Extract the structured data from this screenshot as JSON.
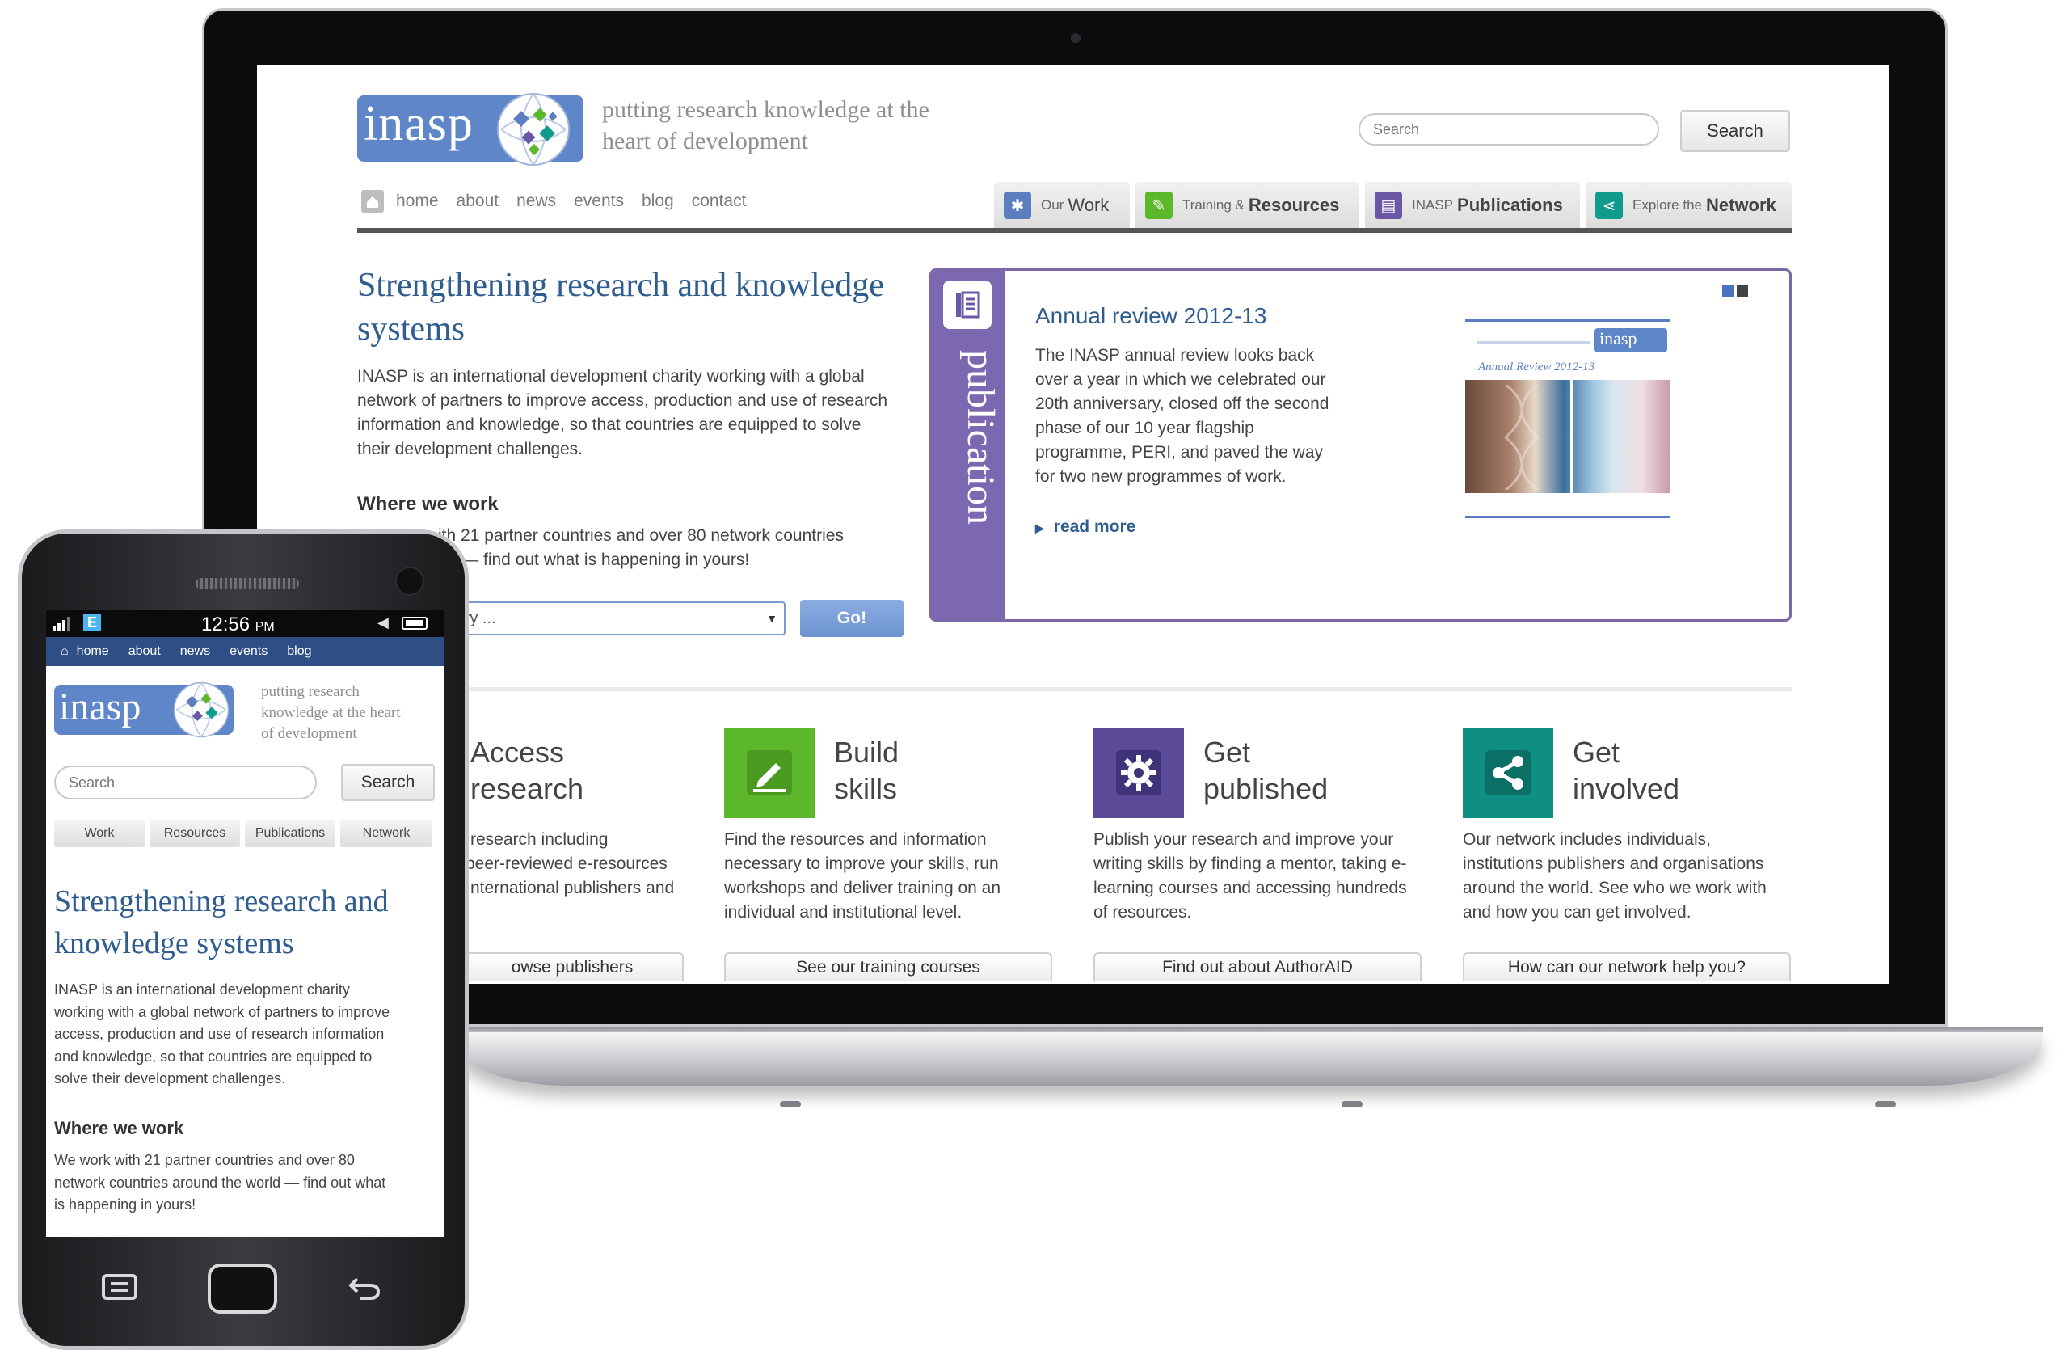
{
  "site": {
    "logo_text": "inasp",
    "tagline": "putting research knowledge at the heart of development",
    "tagline_line1": "putting research knowledge at the",
    "tagline_line2": "heart of development"
  },
  "search": {
    "placeholder": "Search",
    "button_label": "Search"
  },
  "nav": {
    "items": [
      "home",
      "about",
      "news",
      "events",
      "blog",
      "contact"
    ]
  },
  "tabs": [
    {
      "small": "Our",
      "big": "Work",
      "icon": "gear-icon",
      "color": "#5a7ec0"
    },
    {
      "small": "Training &",
      "big": "Resources",
      "icon": "pencil-icon",
      "color": "#5cb82a"
    },
    {
      "small": "INASP",
      "big": "Publications",
      "icon": "book-icon",
      "color": "#6a58a6"
    },
    {
      "small": "Explore the",
      "big": "Network",
      "icon": "share-icon",
      "color": "#109b8c"
    }
  ],
  "main": {
    "heading_line1": "Strengthening research and knowledge",
    "heading_line2": "systems",
    "intro_lines": [
      "INASP is an international development charity working with a global",
      "network of partners to improve access, production and use of research",
      "information and knowledge, so that countries are equipped to solve",
      "their development challenges."
    ],
    "where_title": "Where we work",
    "where_line1": "ith 21 partner countries and over 80 network countries",
    "where_line2": "rld — find out what is happening in yours!",
    "country_select": "ntry ...",
    "go_label": "Go!"
  },
  "publication": {
    "strip_label": "publication",
    "title": "Annual review 2012-13",
    "lines": [
      "The INASP annual review looks back",
      "over a year in which we celebrated our",
      "20th anniversary, closed off the second",
      "phase of our 10 year flagship",
      "programme, PERI, and paved the way",
      "for two new programmes of work."
    ],
    "read_more": "read more",
    "cover_logo": "inasp",
    "cover_title": "Annual Review 2012-13"
  },
  "features": [
    {
      "title1": "Access",
      "title2": "research",
      "color": "#5a7ec0",
      "icon": "book-icon",
      "lines": [
        "research including",
        "peer-reviewed e-resources",
        "nternational publishers and"
      ],
      "button": "owse publishers"
    },
    {
      "title1": "Build",
      "title2": "skills",
      "color": "#5cb82a",
      "icon": "pencil-icon",
      "lines": [
        "Find the resources and information",
        "necessary to improve your skills, run",
        "workshops and deliver training on an",
        "individual and institutional level."
      ],
      "button": "See our training courses"
    },
    {
      "title1": "Get",
      "title2": "published",
      "color": "#5a4a97",
      "icon": "gear-icon",
      "lines": [
        "Publish your research and improve your",
        "writing skills by finding a mentor, taking e-",
        "learning courses and accessing hundreds",
        "of resources."
      ],
      "button": "Find out about AuthorAID"
    },
    {
      "title1": "Get",
      "title2": "involved",
      "color": "#0f8f82",
      "icon": "share-icon",
      "lines": [
        "Our network includes individuals,",
        "institutions publishers and organisations",
        "around the world. See who we work with",
        "and how you can get involved."
      ],
      "button": "How can our network help you?"
    }
  ],
  "phone": {
    "time": "12:56",
    "ampm": "PM",
    "network": "E",
    "nav": [
      "home",
      "about",
      "news",
      "events",
      "blog"
    ],
    "tagline_lines": [
      "putting research",
      "knowledge at the heart",
      "of development"
    ],
    "tabs": [
      "Work",
      "Resources",
      "Publications",
      "Network"
    ],
    "heading_line1": "Strengthening research and",
    "heading_line2": "knowledge systems",
    "intro_lines": [
      "INASP is an international development charity",
      "working with a global network of partners to improve",
      "access, production and use of research information",
      "and knowledge, so that countries are equipped to",
      "solve their development challenges."
    ],
    "where_title": "Where we work",
    "where_lines": [
      "We work with 21 partner countries and over 80",
      "network countries around the world — find out what",
      "is happening in yours!"
    ]
  }
}
